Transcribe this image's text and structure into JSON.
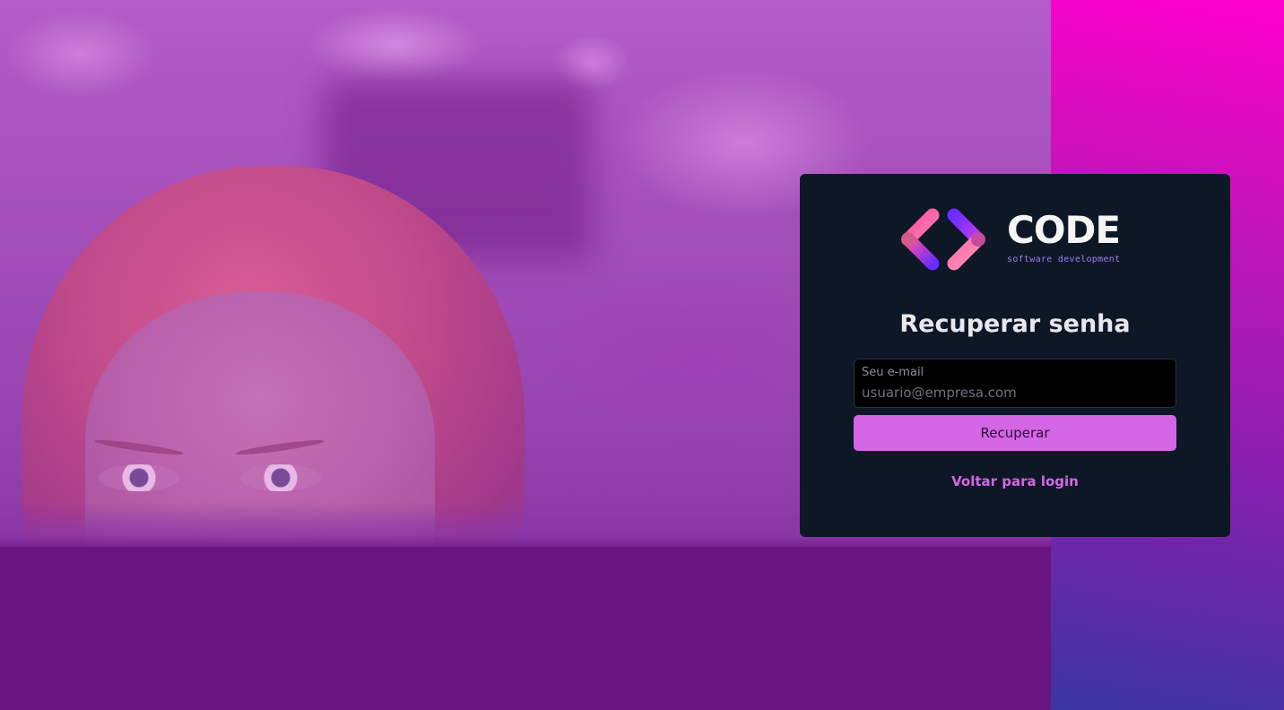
{
  "brand": {
    "name": "CODE",
    "tagline": "software development",
    "logo_icon": "code-brackets-icon"
  },
  "form": {
    "title": "Recuperar senha",
    "email_label": "Seu e-mail",
    "email_placeholder": "usuario@empresa.com",
    "email_value": "",
    "submit_label": "Recuperar",
    "back_link_label": "Voltar para login"
  },
  "colors": {
    "accent": "#d466e6",
    "card_bg": "#0e1726",
    "gradient_top": "#ff00cc",
    "gradient_bottom": "#3a35a0"
  }
}
